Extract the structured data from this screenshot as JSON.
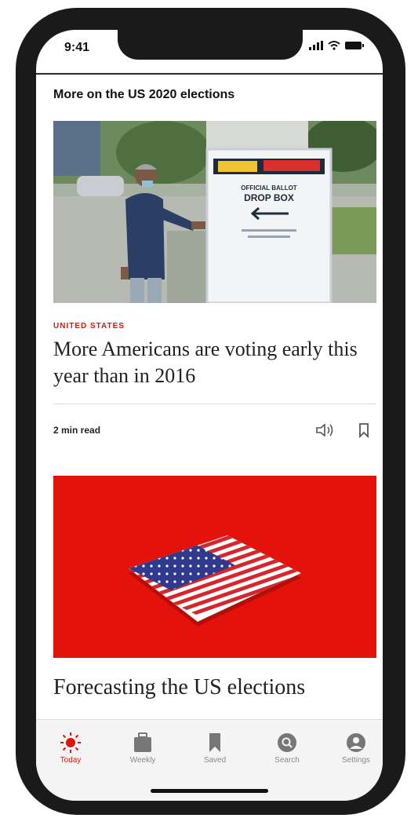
{
  "status_bar": {
    "time": "9:41"
  },
  "section": {
    "title": "More on the US 2020 elections"
  },
  "article1": {
    "kicker": "UNITED STATES",
    "headline": "More Americans are voting early this year than in 2016",
    "read_time": "2 min read",
    "image": {
      "sign_line1": "OFFICIAL BALLOT",
      "sign_line2": "DROP BOX"
    }
  },
  "article2": {
    "headline": "Forecasting the US elections"
  },
  "tabs": [
    {
      "label": "Today",
      "icon": "sun-icon",
      "active": true
    },
    {
      "label": "Weekly",
      "icon": "briefcase-icon",
      "active": false
    },
    {
      "label": "Saved",
      "icon": "bookmark-icon",
      "active": false
    },
    {
      "label": "Search",
      "icon": "search-icon",
      "active": false
    },
    {
      "label": "Settings",
      "icon": "user-icon",
      "active": false
    }
  ],
  "colors": {
    "accent": "#e3120b",
    "text": "#222222",
    "tab_inactive": "#8a8a8a"
  }
}
